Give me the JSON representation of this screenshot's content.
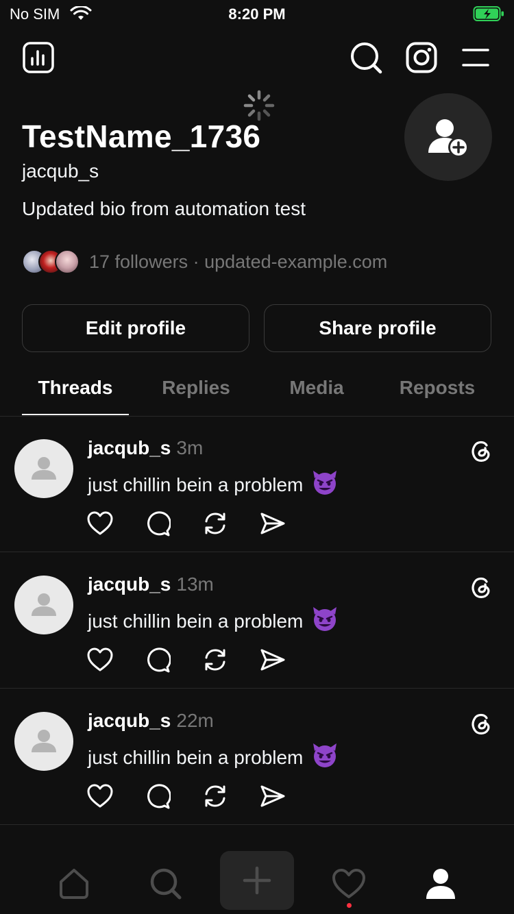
{
  "status_bar": {
    "carrier": "No SIM",
    "time": "8:20 PM",
    "battery_color": "#30d158"
  },
  "header": {
    "icons": [
      "insights-icon",
      "search-icon",
      "instagram-icon",
      "menu-icon"
    ]
  },
  "profile": {
    "display_name": "TestName_1736",
    "username": "jacqub_s",
    "bio": "Updated bio from automation test",
    "followers_text": "17 followers · updated-example.com",
    "edit_button": "Edit profile",
    "share_button": "Share profile"
  },
  "tabs": [
    {
      "label": "Threads",
      "active": true
    },
    {
      "label": "Replies",
      "active": false
    },
    {
      "label": "Media",
      "active": false
    },
    {
      "label": "Reposts",
      "active": false
    }
  ],
  "posts": [
    {
      "username": "jacqub_s",
      "time": "3m",
      "text": "just chillin bein a problem",
      "emoji": "smiling-devil"
    },
    {
      "username": "jacqub_s",
      "time": "13m",
      "text": "just chillin bein a problem",
      "emoji": "smiling-devil"
    },
    {
      "username": "jacqub_s",
      "time": "22m",
      "text": "just chillin bein a problem",
      "emoji": "smiling-devil"
    }
  ],
  "bottom_nav": {
    "items": [
      "home-icon",
      "search-icon",
      "create-icon",
      "activity-icon",
      "profile-icon"
    ],
    "active": "profile-icon",
    "notification_color": "#ff3040"
  },
  "colors": {
    "background": "#101010",
    "text": "#f3f5f7",
    "muted": "#777777",
    "divider": "#2a2a2a"
  }
}
